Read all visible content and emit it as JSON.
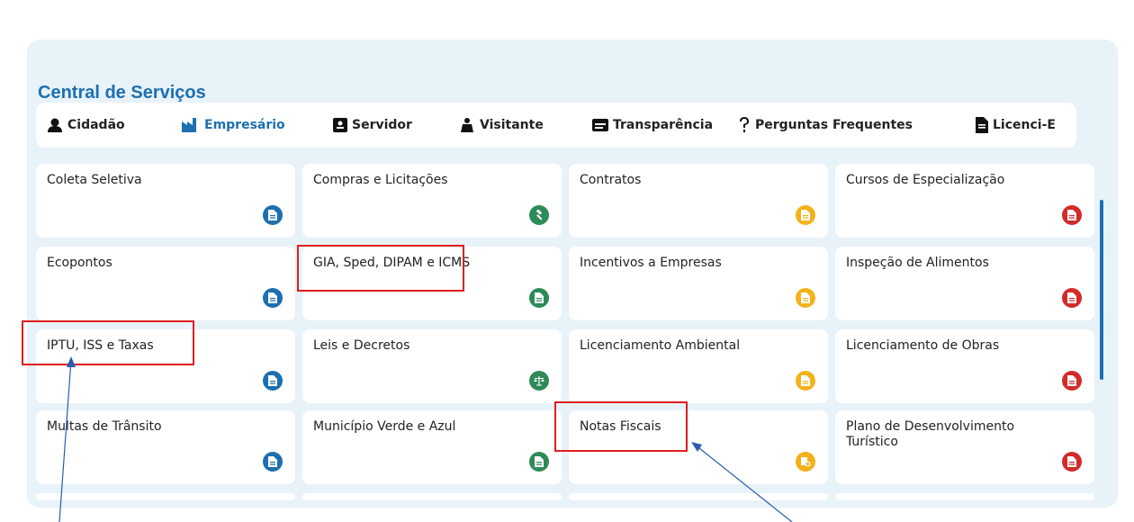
{
  "header": {
    "title": "Central de Serviços"
  },
  "tabs": [
    {
      "label": "Cidadão",
      "icon": "user-icon",
      "active": false
    },
    {
      "label": "Empresário",
      "icon": "factory-icon",
      "active": true
    },
    {
      "label": "Servidor",
      "icon": "id-badge-icon",
      "active": false
    },
    {
      "label": "Visitante",
      "icon": "traveler-icon",
      "active": false
    },
    {
      "label": "Transparência",
      "icon": "document-lines-icon",
      "active": false
    },
    {
      "label": "Perguntas Frequentes",
      "icon": "question-icon",
      "active": false
    },
    {
      "label": "Licenci-E",
      "icon": "file-icon",
      "active": false
    }
  ],
  "cards": [
    {
      "label": "Coleta Seletiva",
      "icon": "document-icon",
      "color": "#1d6fb0"
    },
    {
      "label": "Compras e Licitações",
      "icon": "gavel-icon",
      "color": "#2e8b57"
    },
    {
      "label": "Contratos",
      "icon": "document-icon",
      "color": "#f2b21b"
    },
    {
      "label": "Cursos de Especialização",
      "icon": "document-icon",
      "color": "#d32a2a"
    },
    {
      "label": "Ecopontos",
      "icon": "document-icon",
      "color": "#1d6fb0"
    },
    {
      "label": "GIA, Sped, DIPAM e ICMS",
      "icon": "document-icon",
      "color": "#2e8b57"
    },
    {
      "label": "Incentivos a Empresas",
      "icon": "document-icon",
      "color": "#f2b21b"
    },
    {
      "label": "Inspeção de Alimentos",
      "icon": "document-icon",
      "color": "#d32a2a"
    },
    {
      "label": "IPTU, ISS e Taxas",
      "icon": "document-icon",
      "color": "#1d6fb0"
    },
    {
      "label": "Leis e Decretos",
      "icon": "scales-icon",
      "color": "#2e8b57"
    },
    {
      "label": "Licenciamento Ambiental",
      "icon": "document-icon",
      "color": "#f2b21b"
    },
    {
      "label": "Licenciamento de Obras",
      "icon": "document-icon",
      "color": "#d32a2a"
    },
    {
      "label": "Multas de Trânsito",
      "icon": "document-icon",
      "color": "#1d6fb0"
    },
    {
      "label": "Município Verde e Azul",
      "icon": "document-icon",
      "color": "#2e8b57"
    },
    {
      "label": "Notas Fiscais",
      "icon": "receipt-icon",
      "color": "#f2b21b"
    },
    {
      "label": "Plano de Desenvolvimento Turístico",
      "icon": "document-icon",
      "color": "#d32a2a"
    }
  ],
  "colors": {
    "accent": "#1d6fb0",
    "panel": "#e8f2f9",
    "highlight": "#e11d1d",
    "arrow": "#2a5db0"
  }
}
